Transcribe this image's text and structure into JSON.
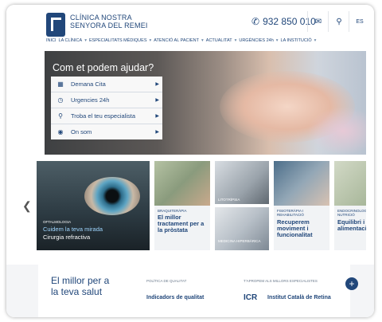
{
  "header": {
    "brand_line1": "CLÍNICA NOSTRA",
    "brand_line2": "SENYORA DEL REMEI",
    "phone": "932 850 010",
    "lang": "ES",
    "mail_icon": "mail-icon",
    "search_icon": "search-icon"
  },
  "nav": [
    "INICI",
    "LA CLÍNICA",
    "ESPECIALITATS MÈDIQUES",
    "ATENCIÓ AL PACIENT",
    "ACTUALITAT",
    "URGÈNCIES 24h",
    "LA INSTITUCIÓ"
  ],
  "hero": {
    "title": "Com et podem ajudar?",
    "menu": [
      {
        "label": "Demana Cita",
        "icon": "calendar-icon"
      },
      {
        "label": "Urgencies 24h",
        "icon": "clock-icon"
      },
      {
        "label": "Troba el teu especialista",
        "icon": "stethoscope-icon"
      },
      {
        "label": "On som",
        "icon": "location-icon"
      }
    ]
  },
  "cards": [
    {
      "category": "OFTALMOLOGIA",
      "title": "Cuidem la teva mirada",
      "subtitle": "Cirurgia refractiva"
    },
    {
      "category": "BRAQUITERÀPIA",
      "title": "El millor tractament per a la pròstata"
    },
    {
      "category": "LITOTRÍPSIA",
      "title": ""
    },
    {
      "category": "MEDICINA HIPERBÀRICA",
      "title": ""
    },
    {
      "category": "FISIOTERÀPIA I REHABILITACIÓ",
      "title": "Recuperem moviment i funcionalitat"
    },
    {
      "category": "ENDOCRINOLOGIA I NUTRICIÓ",
      "title": "Equilibri i alimentació"
    }
  ],
  "bottom": {
    "slogan_line1": "El millor per a",
    "slogan_line2": "la teva salut",
    "col1_header": "POLÍTICA DE QUALITAT",
    "col1_value": "Indicadors de qualitat",
    "col2_header": "T'APROPEM ALS MILLORS ESPECIALISTES",
    "col2_logo": "ICR",
    "col2_value": "Institut Català de Retina",
    "plus": "+"
  },
  "colors": {
    "brand": "#21477a"
  }
}
